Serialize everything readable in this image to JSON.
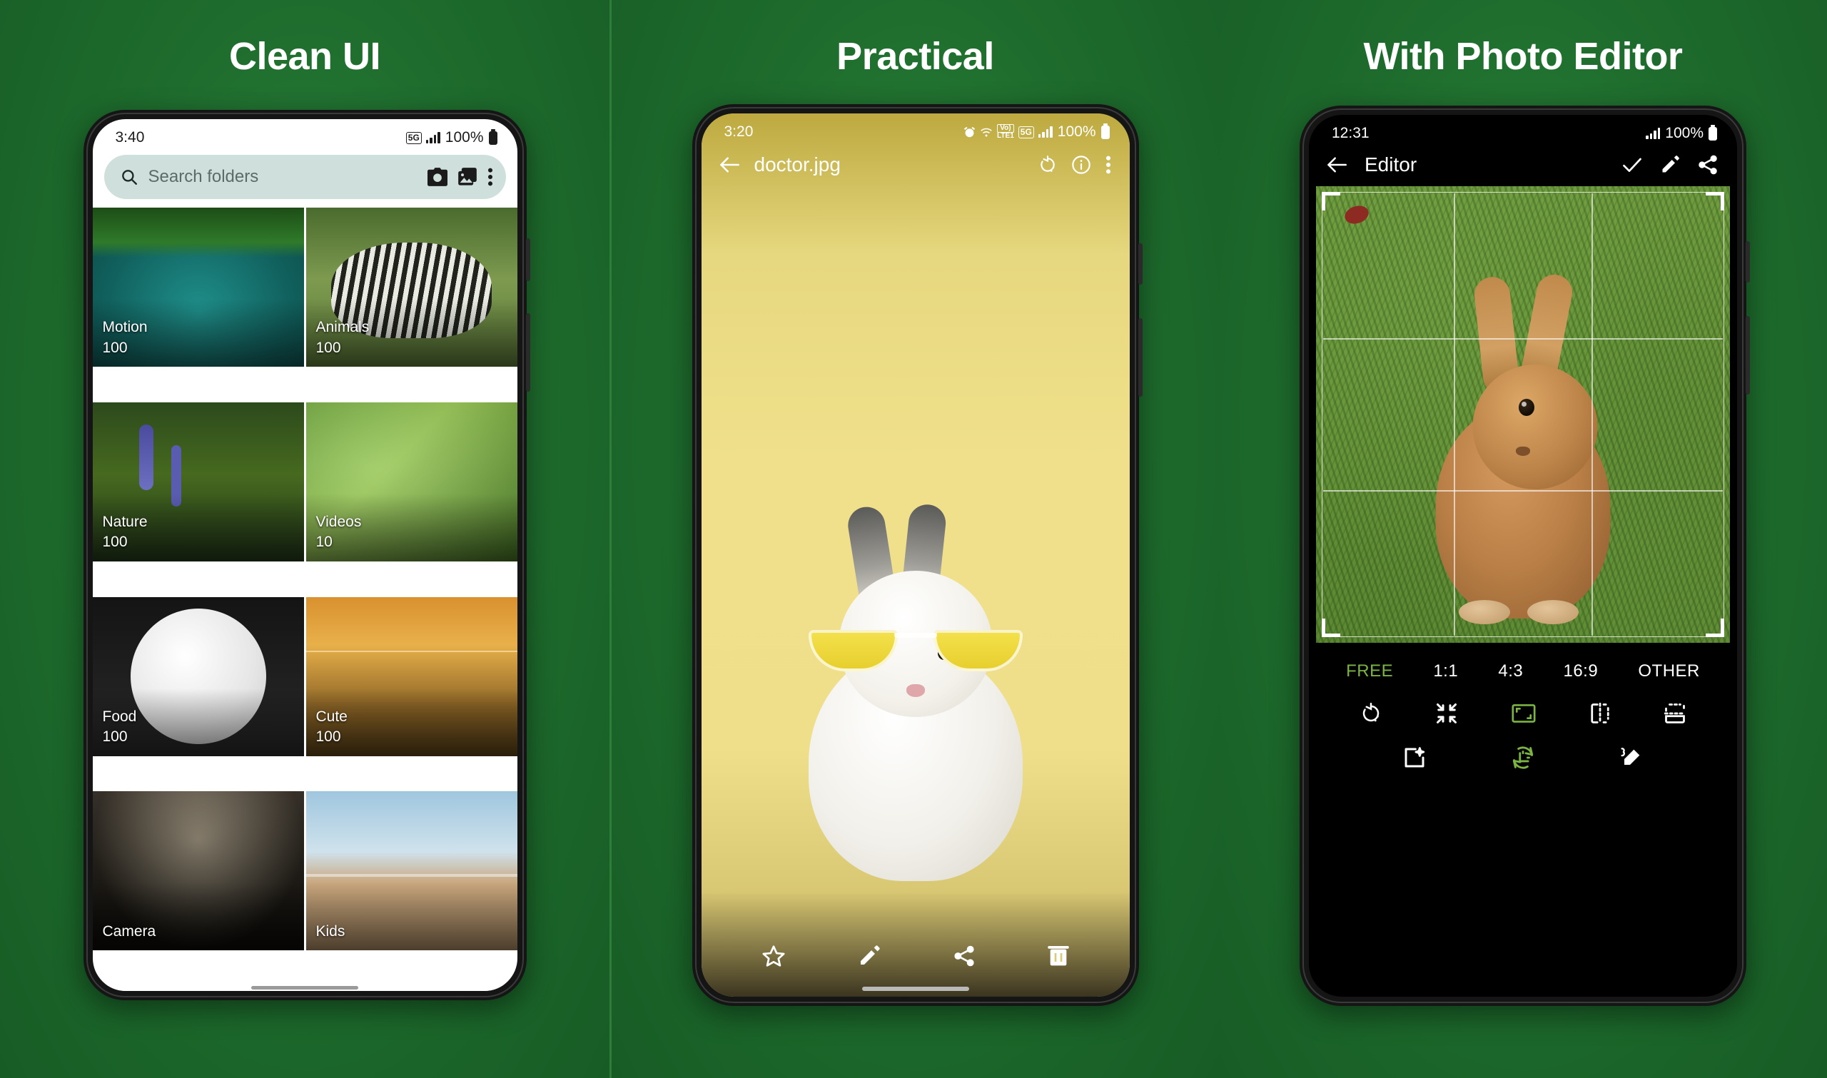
{
  "panels": [
    {
      "title": "Clean UI"
    },
    {
      "title": "Practical"
    },
    {
      "title": "With Photo Editor"
    }
  ],
  "panel1": {
    "status": {
      "time": "3:40",
      "network": "5G",
      "battery_pct": "100%"
    },
    "search": {
      "placeholder": "Search folders"
    },
    "actions": {
      "camera": "camera-icon",
      "gallery": "gallery-icon",
      "overflow": "more-vert-icon"
    },
    "folders": [
      {
        "name": "Motion",
        "count": "100"
      },
      {
        "name": "Animals",
        "count": "100"
      },
      {
        "name": "Nature",
        "count": "100"
      },
      {
        "name": "Videos",
        "count": "10"
      },
      {
        "name": "Food",
        "count": "100"
      },
      {
        "name": "Cute",
        "count": "100"
      },
      {
        "name": "Camera",
        "count": ""
      },
      {
        "name": "Kids",
        "count": ""
      }
    ]
  },
  "panel2": {
    "status": {
      "time": "3:20",
      "alarm": "alarm-icon",
      "wifi": "wifi-icon",
      "volte": "VoLTE1",
      "network": "5G",
      "battery_pct": "100%"
    },
    "appbar": {
      "back": "back-arrow-icon",
      "filename": "doctor.jpg",
      "rotate": "rotate-icon",
      "info": "info-icon",
      "overflow": "more-vert-icon"
    },
    "toolbar": [
      {
        "name": "favorite",
        "icon": "star-icon"
      },
      {
        "name": "edit",
        "icon": "pencil-icon"
      },
      {
        "name": "share",
        "icon": "share-icon"
      },
      {
        "name": "delete",
        "icon": "trash-icon"
      }
    ]
  },
  "panel3": {
    "status": {
      "time": "12:31",
      "battery_pct": "100%"
    },
    "appbar": {
      "back": "back-arrow-icon",
      "title": "Editor",
      "confirm": "check-icon",
      "edit": "pencil-icon",
      "share": "share-icon"
    },
    "ratios": [
      {
        "label": "FREE",
        "selected": true
      },
      {
        "label": "1:1",
        "selected": false
      },
      {
        "label": "4:3",
        "selected": false
      },
      {
        "label": "16:9",
        "selected": false
      },
      {
        "label": "OTHER",
        "selected": false
      }
    ],
    "tools": [
      {
        "name": "rotate",
        "icon": "rotate-icon",
        "active": false
      },
      {
        "name": "shrink",
        "icon": "shrink-icon",
        "active": false
      },
      {
        "name": "aspect-ratio",
        "icon": "aspect-ratio-icon",
        "active": true
      },
      {
        "name": "flip-horizontal",
        "icon": "flip-h-icon",
        "active": false
      },
      {
        "name": "flip-vertical",
        "icon": "flip-v-icon",
        "active": false
      }
    ],
    "modes": [
      {
        "name": "filters",
        "icon": "magic-wand-icon",
        "active": false
      },
      {
        "name": "crop-rotate",
        "icon": "crop-rotate-icon",
        "active": true
      },
      {
        "name": "draw",
        "icon": "draw-icon",
        "active": false
      }
    ],
    "colors": {
      "accent": "#7cb342"
    }
  }
}
